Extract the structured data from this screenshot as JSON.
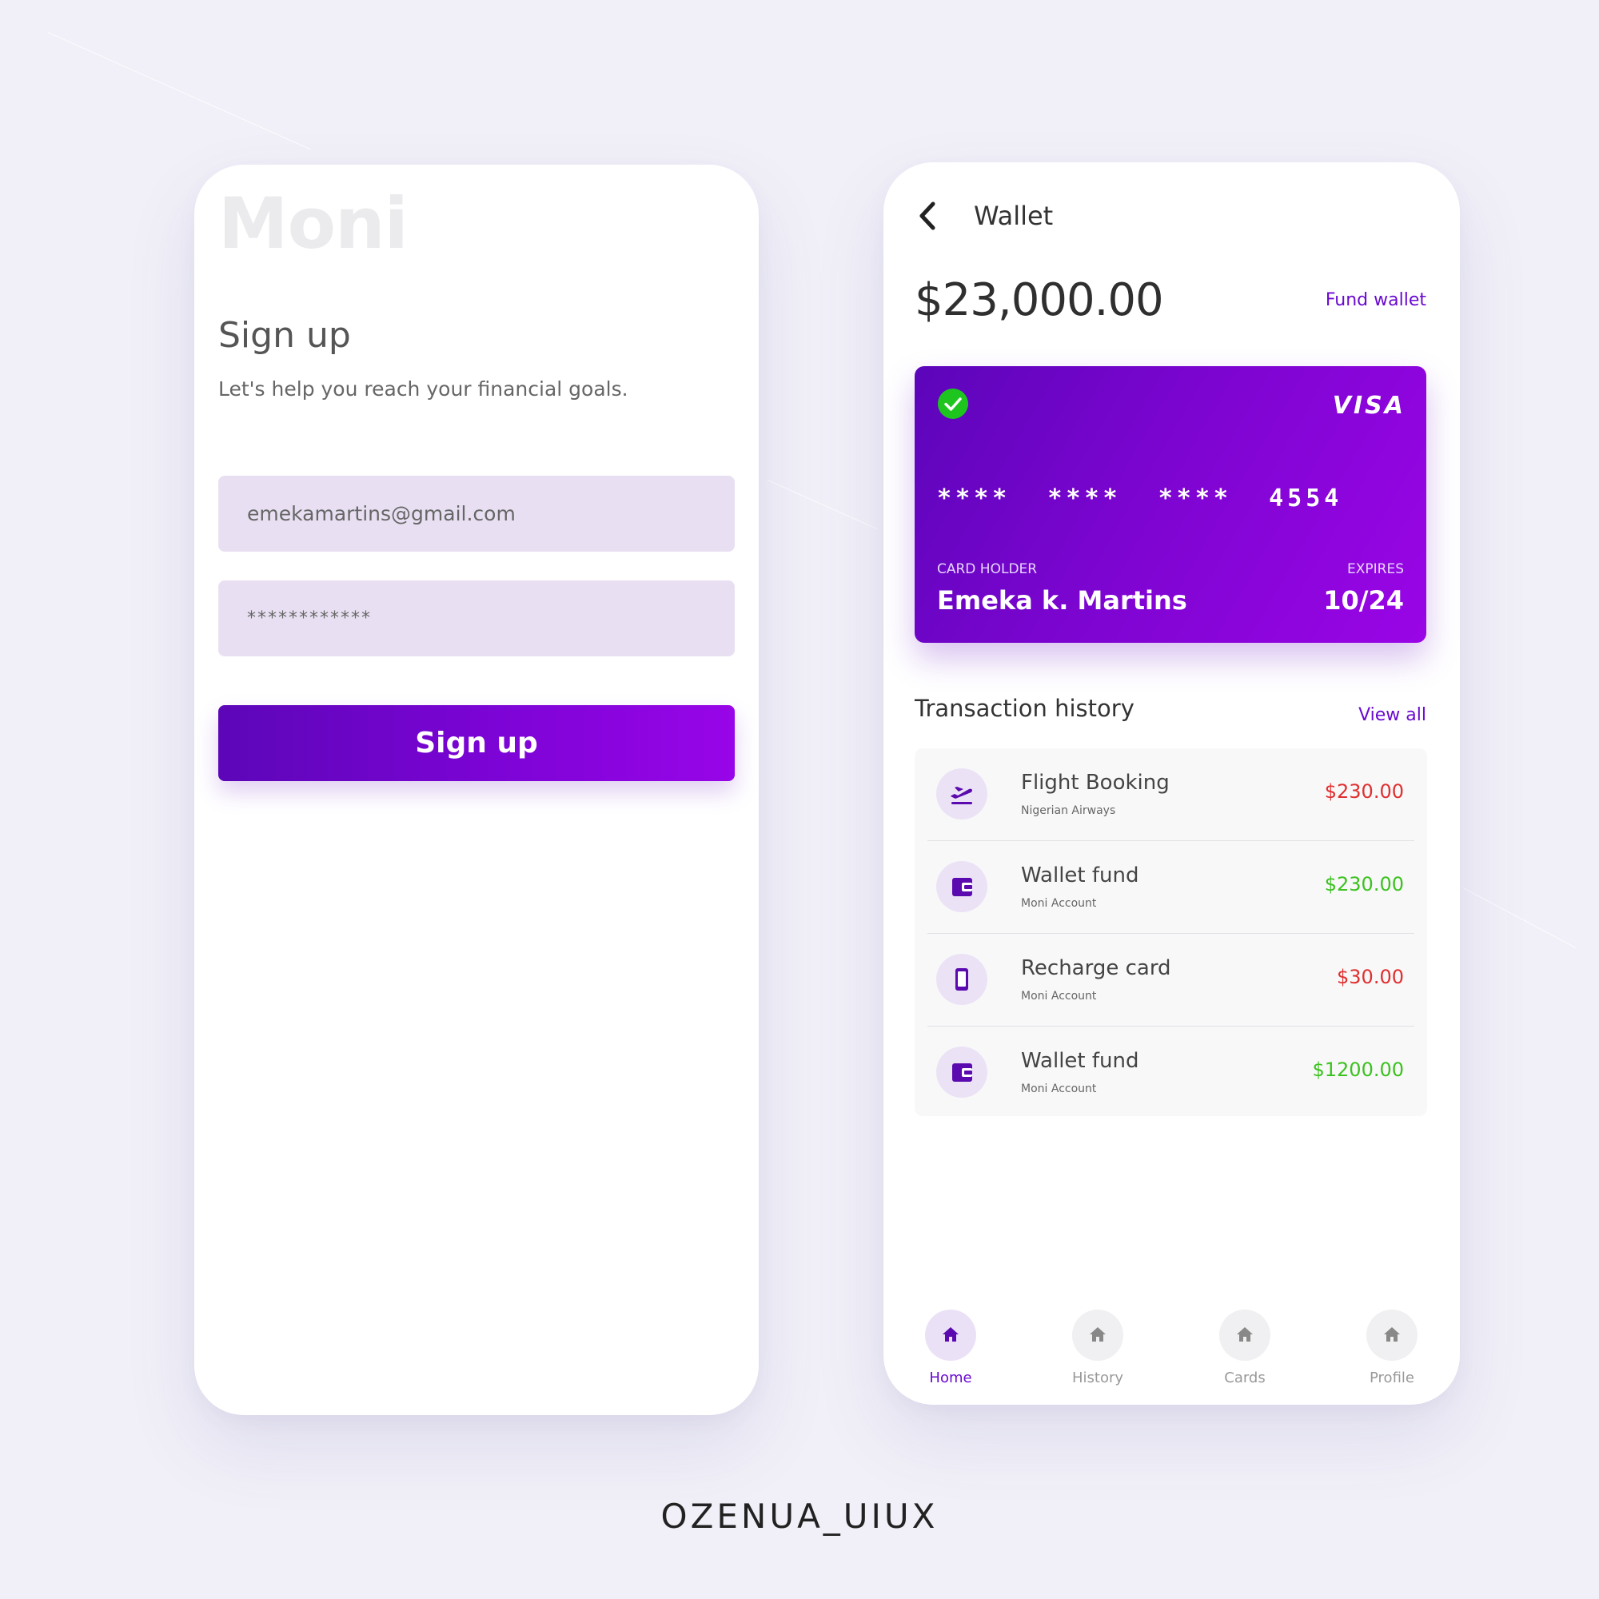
{
  "colors": {
    "accent": "#6a0ad0",
    "card_gradient_start": "#5c05ba",
    "card_gradient_end": "#9a05e6",
    "debit": "#e03030",
    "credit": "#3cc21f",
    "check_green": "#1ec51e"
  },
  "signup": {
    "brand": "Moni",
    "title": "Sign up",
    "subtitle": "Let's help you reach your financial goals.",
    "email_value": "emekamartins@gmail.com",
    "password_value": "************",
    "button_label": "Sign up"
  },
  "wallet": {
    "back_icon": "chevron-left-icon",
    "title": "Wallet",
    "balance": "$23,000.00",
    "fund_link": "Fund wallet",
    "card": {
      "status_icon": "check-circle-icon",
      "brand": "VISA",
      "number": "****  ****  ****  4554",
      "holder_label": "CARD HOLDER",
      "holder_name": "Emeka k. Martins",
      "expires_label": "EXPIRES",
      "expires_value": "10/24"
    },
    "history": {
      "title": "Transaction history",
      "view_all": "View all",
      "items": [
        {
          "icon": "flight-takeoff-icon",
          "title": "Flight Booking",
          "subtitle": "Nigerian Airways",
          "amount": "$230.00",
          "type": "debit"
        },
        {
          "icon": "wallet-icon",
          "title": "Wallet fund",
          "subtitle": "Moni Account",
          "amount": "$230.00",
          "type": "credit"
        },
        {
          "icon": "phone-icon",
          "title": "Recharge card",
          "subtitle": "Moni Account",
          "amount": "$30.00",
          "type": "debit"
        },
        {
          "icon": "wallet-icon",
          "title": "Wallet fund",
          "subtitle": "Moni Account",
          "amount": "$1200.00",
          "type": "credit"
        }
      ]
    },
    "nav": [
      {
        "icon": "home-icon",
        "label": "Home",
        "active": true
      },
      {
        "icon": "home-icon",
        "label": "History",
        "active": false
      },
      {
        "icon": "home-icon",
        "label": "Cards",
        "active": false
      },
      {
        "icon": "home-icon",
        "label": "Profile",
        "active": false
      }
    ]
  },
  "watermark": "OZENUA_UIUX"
}
